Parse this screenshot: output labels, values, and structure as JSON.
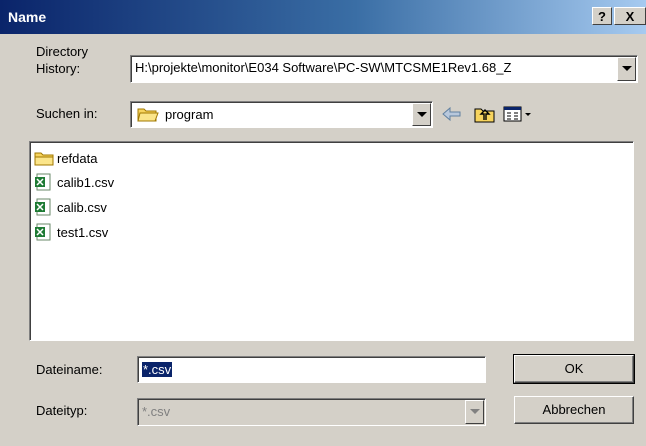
{
  "window": {
    "title": "Name",
    "help_label": "?",
    "close_label": "X"
  },
  "history": {
    "label_line1": "Directory",
    "label_line2": "History:",
    "value": "H:\\projekte\\monitor\\E034 Software\\PC-SW\\MTCSME1Rev1.68_Z"
  },
  "lookin": {
    "label": "Suchen in:",
    "value": "program"
  },
  "files": [
    {
      "name": "refdata",
      "type": "folder"
    },
    {
      "name": "calib1.csv",
      "type": "csv"
    },
    {
      "name": "calib.csv",
      "type": "csv"
    },
    {
      "name": "test1.csv",
      "type": "csv"
    }
  ],
  "filename": {
    "label": "Dateiname:",
    "value": "*.csv"
  },
  "filetype": {
    "label": "Dateityp:",
    "value": "*.csv"
  },
  "buttons": {
    "ok": "OK",
    "cancel": "Abbrechen"
  }
}
